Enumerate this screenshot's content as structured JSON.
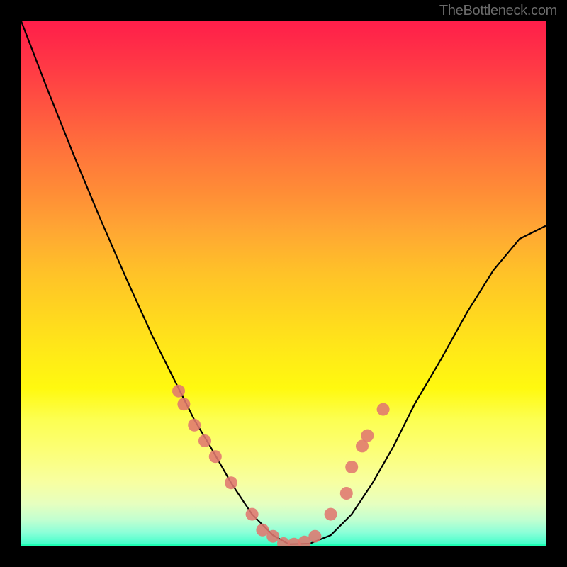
{
  "watermark": "TheBottleneck.com",
  "chart_data": {
    "type": "line",
    "title": "",
    "xlabel": "",
    "ylabel": "",
    "x_range_frac": [
      0,
      1
    ],
    "y_range_frac": [
      0,
      1
    ],
    "note": "Y ≈ bottleneck: 0 = none (bottom/green), 1 = max (top/red). Values are read-off fractions of plot height from the bottom.",
    "series": [
      {
        "name": "bottleneck-curve",
        "color": "#000000",
        "x_frac": [
          0.0,
          0.05,
          0.1,
          0.15,
          0.2,
          0.25,
          0.3,
          0.33,
          0.36,
          0.4,
          0.44,
          0.48,
          0.51,
          0.55,
          0.59,
          0.63,
          0.67,
          0.71,
          0.75,
          0.8,
          0.85,
          0.9,
          0.95,
          1.0
        ],
        "y_frac": [
          1.0,
          0.87,
          0.745,
          0.625,
          0.51,
          0.4,
          0.3,
          0.24,
          0.19,
          0.12,
          0.06,
          0.02,
          0.003,
          0.004,
          0.02,
          0.06,
          0.12,
          0.19,
          0.27,
          0.355,
          0.445,
          0.525,
          0.585,
          0.61
        ]
      },
      {
        "name": "highlight-dots",
        "color": "#e0776f",
        "radius_px": 9,
        "x_frac": [
          0.3,
          0.31,
          0.33,
          0.35,
          0.37,
          0.4,
          0.44,
          0.46,
          0.48,
          0.5,
          0.52,
          0.54,
          0.56,
          0.59,
          0.62,
          0.63,
          0.65,
          0.66,
          0.69
        ],
        "y_frac": [
          0.295,
          0.27,
          0.23,
          0.2,
          0.17,
          0.12,
          0.06,
          0.03,
          0.018,
          0.004,
          0.003,
          0.007,
          0.018,
          0.06,
          0.1,
          0.15,
          0.19,
          0.21,
          0.26
        ]
      }
    ],
    "background": {
      "gradient": "vertical-red-to-green",
      "colors_top_to_bottom": [
        "#ff1e4a",
        "#ffd71f",
        "#fcff52",
        "#3affc9"
      ]
    }
  }
}
